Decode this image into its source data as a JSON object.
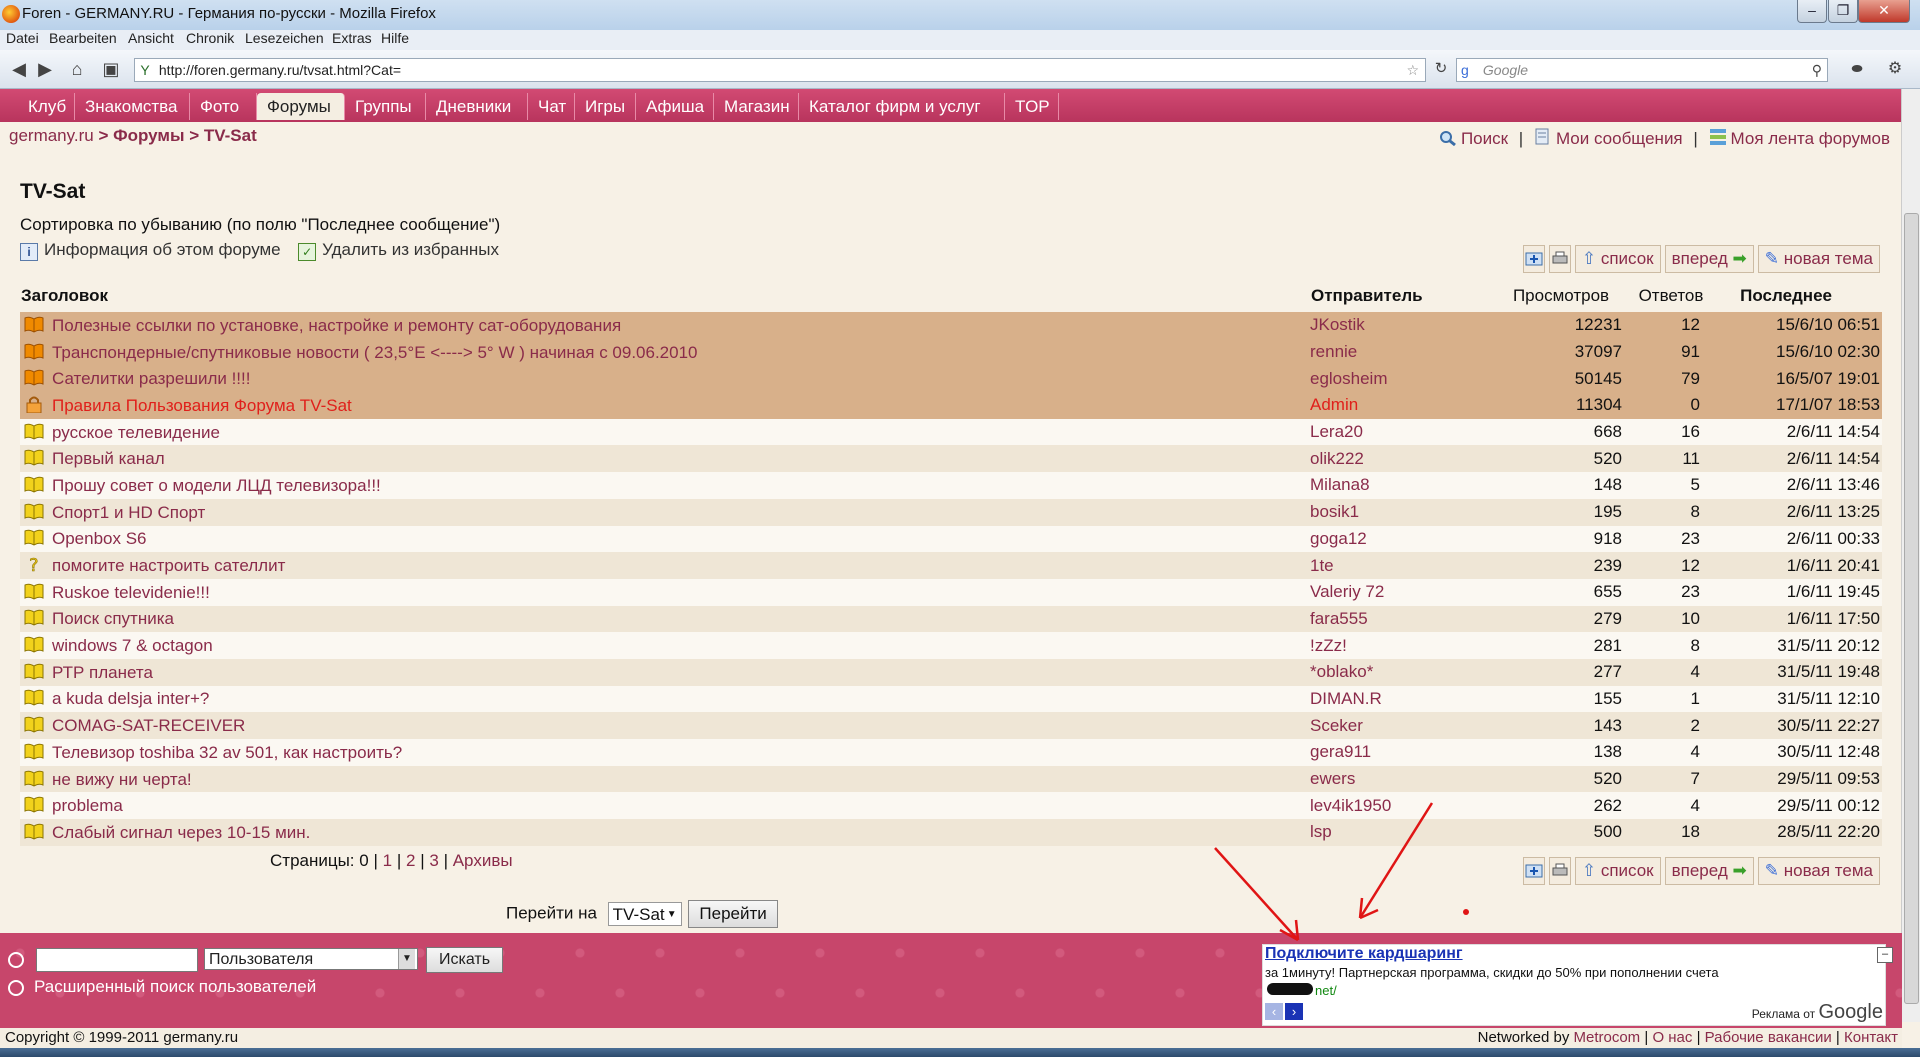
{
  "window": {
    "title": "Foren - GERMANY.RU - Германия по-русски - Mozilla Firefox",
    "menu": [
      "Datei",
      "Bearbeiten",
      "Ansicht",
      "Chronik",
      "Lesezeichen",
      "Extras",
      "Hilfe"
    ],
    "url": "http://foren.germany.ru/tvsat.html?Cat=",
    "search_placeholder": "Google"
  },
  "tabs": [
    {
      "label": "Клуб"
    },
    {
      "label": "Знакомства"
    },
    {
      "label": "Фото"
    },
    {
      "label": "Форумы",
      "active": true
    },
    {
      "label": "Группы"
    },
    {
      "label": "Дневники"
    },
    {
      "label": "Чат"
    },
    {
      "label": "Игры"
    },
    {
      "label": "Афиша"
    },
    {
      "label": "Магазин"
    },
    {
      "label": "Каталог фирм и услуг"
    },
    {
      "label": "TOP"
    }
  ],
  "breadcrumb": {
    "home": "germany.ru",
    "sep": " > ",
    "forums": "Форумы",
    "current": "TV-Sat"
  },
  "toplinks": {
    "search": "Поиск",
    "my_messages": "Мои сообщения",
    "my_feed": "Моя лента форумов",
    "sep": "|"
  },
  "forum": {
    "title": "TV-Sat",
    "sort_text": "Сортировка по убыванию (по полю \"Последнее сообщение\")",
    "info_link": "Информация об этом форуме",
    "remove_fav": "Удалить из избранных"
  },
  "actions": {
    "list": "список",
    "forward": "вперед",
    "new_topic": "новая тема"
  },
  "table": {
    "headers": {
      "topic": "Заголовок",
      "sender": "Отправитель",
      "views": "Просмотров",
      "replies": "Ответов",
      "last": "Последнее"
    },
    "rows": [
      {
        "title": "Полезные ссылки по установке, настройке и ремонту сат-оборудования",
        "sender": "JKostik",
        "views": "12231",
        "replies": "12",
        "last": "15/6/10 06:51",
        "kind": "sticky",
        "icon": "orange-book-icon"
      },
      {
        "title": "Транспондерные/спутниковые новости ( 23,5°E <----> 5° W ) начиная с 09.06.2010",
        "sender": "rennie",
        "views": "37097",
        "replies": "91",
        "last": "15/6/10 02:30",
        "kind": "sticky",
        "icon": "orange-book-icon"
      },
      {
        "title": "Сателитки разрешили !!!!",
        "sender": "eglosheim",
        "views": "50145",
        "replies": "79",
        "last": "16/5/07 19:01",
        "kind": "sticky",
        "icon": "orange-book-icon"
      },
      {
        "title": "Правила Пользования Форума TV-Sat",
        "sender": "Admin",
        "views": "11304",
        "replies": "0",
        "last": "17/1/07 18:53",
        "kind": "rules",
        "icon": "lock-icon"
      },
      {
        "title": "русское телевидение",
        "sender": "Lera20",
        "views": "668",
        "replies": "16",
        "last": "2/6/11 14:54",
        "kind": "normal",
        "icon": "yellow-book-icon"
      },
      {
        "title": "Первый канал",
        "sender": "olik222",
        "views": "520",
        "replies": "11",
        "last": "2/6/11 14:54",
        "kind": "normal",
        "icon": "yellow-book-icon"
      },
      {
        "title": "Прошу совет о модели ЛЦД телевизора!!!",
        "sender": "Milana8",
        "views": "148",
        "replies": "5",
        "last": "2/6/11 13:46",
        "kind": "normal",
        "icon": "yellow-book-icon"
      },
      {
        "title": "Спорт1 и HD Спорт",
        "sender": "bosik1",
        "views": "195",
        "replies": "8",
        "last": "2/6/11 13:25",
        "kind": "normal",
        "icon": "yellow-book-icon"
      },
      {
        "title": "Openbox S6",
        "sender": "goga12",
        "views": "918",
        "replies": "23",
        "last": "2/6/11 00:33",
        "kind": "normal",
        "icon": "yellow-book-icon"
      },
      {
        "title": "помогите настроить сателлит",
        "sender": "1te",
        "views": "239",
        "replies": "12",
        "last": "1/6/11 20:41",
        "kind": "normal",
        "icon": "question-icon"
      },
      {
        "title": "Ruskoe televidenie!!!",
        "sender": "Valeriy 72",
        "views": "655",
        "replies": "23",
        "last": "1/6/11 19:45",
        "kind": "normal",
        "icon": "yellow-book-icon"
      },
      {
        "title": "Поиск спутника",
        "sender": "fara555",
        "views": "279",
        "replies": "10",
        "last": "1/6/11 17:50",
        "kind": "normal",
        "icon": "yellow-book-icon"
      },
      {
        "title": "windows 7 & octagon",
        "sender": "!zZz!",
        "views": "281",
        "replies": "8",
        "last": "31/5/11 20:12",
        "kind": "normal",
        "icon": "yellow-book-icon"
      },
      {
        "title": "РТР планета",
        "sender": "*oblako*",
        "views": "277",
        "replies": "4",
        "last": "31/5/11 19:48",
        "kind": "normal",
        "icon": "yellow-book-icon"
      },
      {
        "title": "a kuda delsja inter+?",
        "sender": "DIMAN.R",
        "views": "155",
        "replies": "1",
        "last": "31/5/11 12:10",
        "kind": "normal",
        "icon": "yellow-book-icon"
      },
      {
        "title": "COMAG-SAT-RECEIVER",
        "sender": "Sceker",
        "views": "143",
        "replies": "2",
        "last": "30/5/11 22:27",
        "kind": "normal",
        "icon": "yellow-book-icon"
      },
      {
        "title": "Телевизор toshiba 32 av 501, как настроить?",
        "sender": "gera911",
        "views": "138",
        "replies": "4",
        "last": "30/5/11 12:48",
        "kind": "normal",
        "icon": "yellow-book-icon"
      },
      {
        "title": "не вижу ни черта!",
        "sender": "ewers",
        "views": "520",
        "replies": "7",
        "last": "29/5/11 09:53",
        "kind": "normal",
        "icon": "yellow-book-icon"
      },
      {
        "title": "problema",
        "sender": "lev4ik1950",
        "views": "262",
        "replies": "4",
        "last": "29/5/11 00:12",
        "kind": "normal",
        "icon": "yellow-book-icon"
      },
      {
        "title": "Слабый сигнал через 10-15 мин.",
        "sender": "lsp",
        "views": "500",
        "replies": "18",
        "last": "28/5/11 22:20",
        "kind": "normal",
        "icon": "yellow-book-icon"
      }
    ]
  },
  "pagination": {
    "label": "Страницы:",
    "current": "0",
    "p1": "1",
    "p2": "2",
    "p3": "3",
    "archive": "Архивы",
    "sep": "|"
  },
  "jump": {
    "label": "Перейти на",
    "selected": "TV-Sat",
    "button": "Перейти"
  },
  "footer": {
    "user_select": "Пользователя",
    "search_button": "Искать",
    "advanced": "Расширенный поиск пользователей",
    "copyright": "Copyright © 1999-2011 germany.ru",
    "networked": "Networked by",
    "metrocom": "Metrocom",
    "about": "О нас",
    "jobs": "Рабочие вакансии",
    "contact": "Контакт",
    "sep": "|"
  },
  "ad": {
    "title": "Подключите кардшаринг",
    "text": "за 1минуту! Партнерская программа, скидки до 50% при пополнении счета",
    "url": "net/",
    "ads_by": "Реклама от",
    "google": "Google"
  },
  "colors": {
    "accent": "#c7466b",
    "link": "#8a2b4a",
    "sticky_row": "#d8b08a",
    "rules_red": "#e0201b",
    "ad_link": "#1a33b5"
  }
}
